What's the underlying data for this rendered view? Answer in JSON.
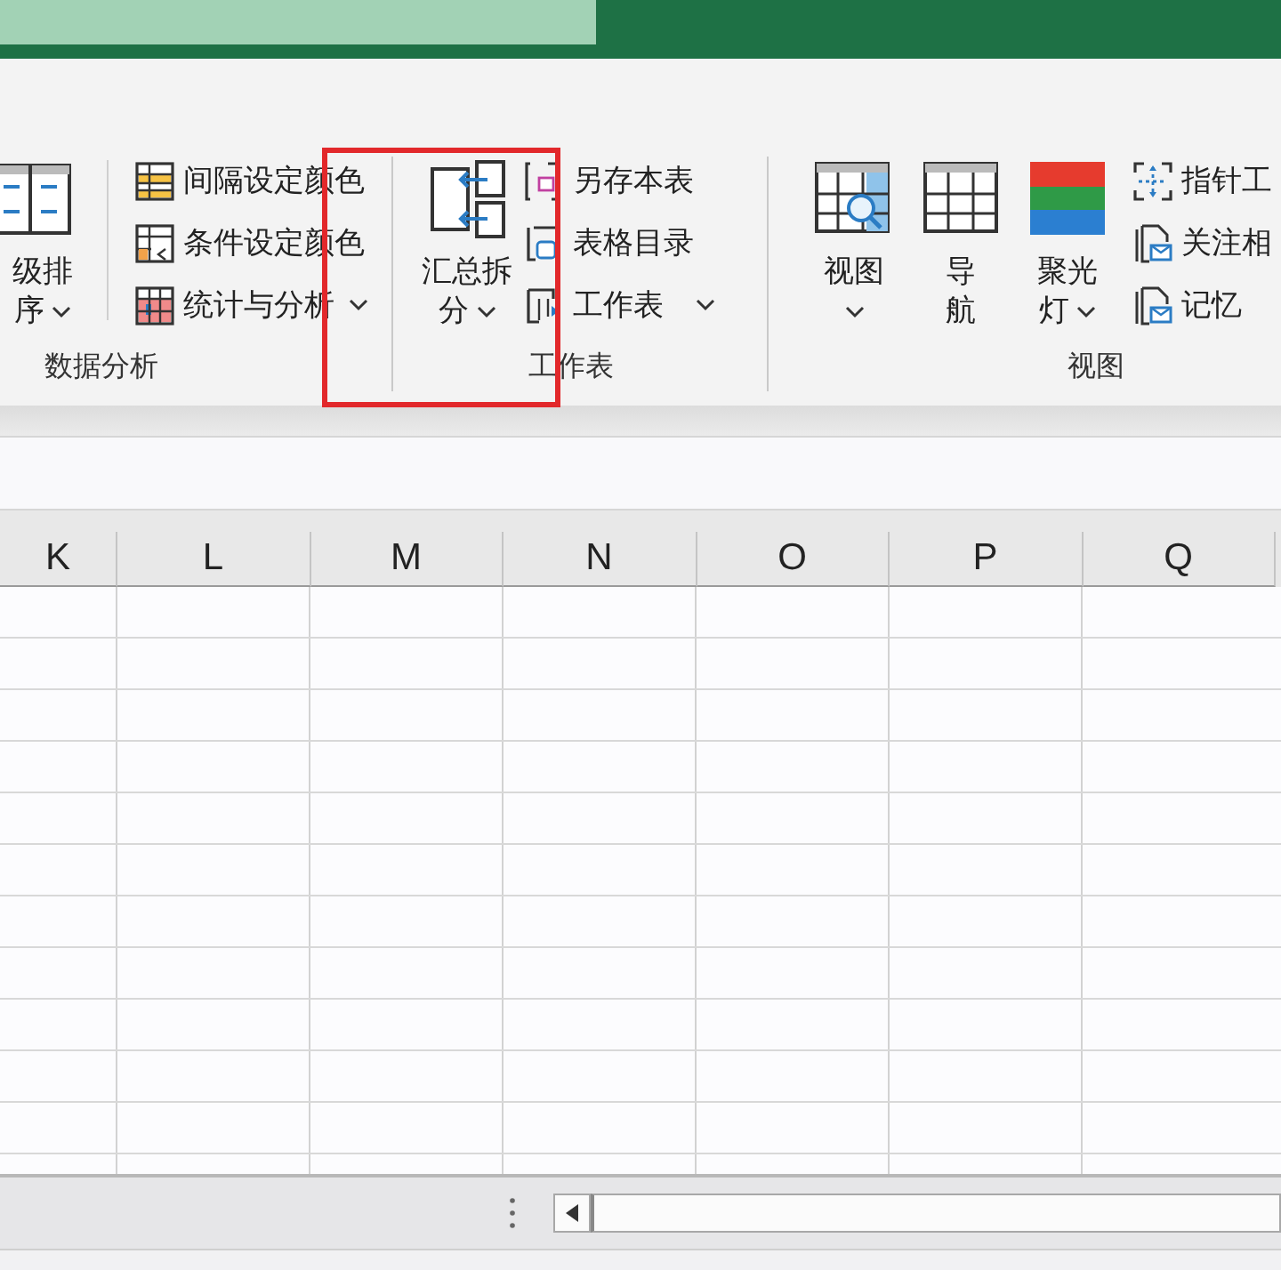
{
  "ribbon": {
    "groups": [
      {
        "label": "数据分析",
        "large_buttons": [
          {
            "lines": [
              "级排",
              "序"
            ],
            "dropdown": true
          }
        ],
        "small_buttons": [
          {
            "label": "间隔设定颜色",
            "dropdown": false
          },
          {
            "label": "条件设定颜色",
            "dropdown": false
          },
          {
            "label": "统计与分析",
            "dropdown": true
          }
        ]
      },
      {
        "label": "工作表",
        "large_buttons": [
          {
            "lines": [
              "汇总拆",
              "分"
            ],
            "dropdown": true
          }
        ],
        "small_buttons": [
          {
            "label": "另存本表",
            "dropdown": false
          },
          {
            "label": "表格目录",
            "dropdown": false
          },
          {
            "label": "工作表",
            "dropdown": true
          }
        ]
      },
      {
        "label": "视图",
        "large_buttons": [
          {
            "lines": [
              "视图"
            ],
            "dropdown": true
          },
          {
            "lines": [
              "导",
              "航"
            ],
            "dropdown": false
          },
          {
            "lines": [
              "聚光",
              "灯"
            ],
            "dropdown": true
          }
        ],
        "small_buttons": [
          {
            "label": "指针工",
            "dropdown": false
          },
          {
            "label": "关注相",
            "dropdown": false
          },
          {
            "label": "记忆",
            "dropdown": false
          }
        ]
      }
    ]
  },
  "annotation": {
    "kind": "red-frame"
  },
  "sheet": {
    "columns": [
      "K",
      "L",
      "M",
      "N",
      "O",
      "P",
      "Q"
    ]
  }
}
